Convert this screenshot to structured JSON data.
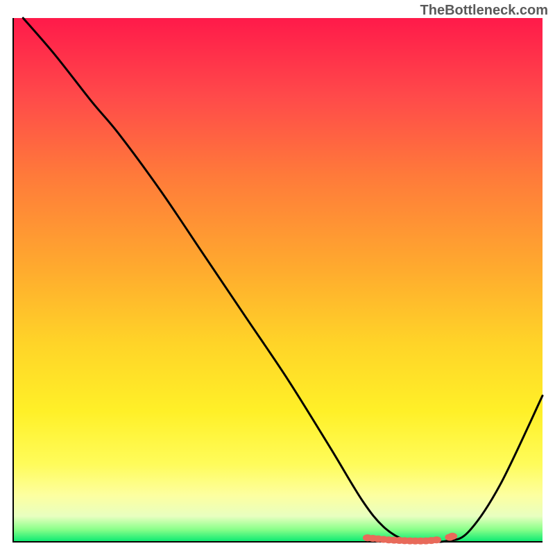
{
  "watermark": "TheBottleneck.com",
  "chart_data": {
    "type": "line",
    "title": "",
    "xlabel": "",
    "ylabel": "",
    "xlim": [
      0,
      100
    ],
    "ylim": [
      0,
      100
    ],
    "series": [
      {
        "name": "bottleneck-curve",
        "x": [
          2,
          8,
          15,
          20,
          28,
          36,
          44,
          52,
          60,
          66,
          70,
          74,
          78,
          82,
          86,
          92,
          100
        ],
        "y": [
          100,
          93,
          84,
          78,
          67,
          55,
          43,
          31,
          18,
          8,
          3,
          0.5,
          0.2,
          0.3,
          2,
          11,
          28
        ]
      }
    ],
    "markers": {
      "name": "optimal-range",
      "color": "#e86a5a",
      "x": [
        67,
        68,
        69,
        70,
        71,
        72,
        73,
        74,
        75,
        76,
        77,
        78,
        79,
        80,
        82.5,
        83
      ],
      "y": [
        0.9,
        0.8,
        0.7,
        0.6,
        0.5,
        0.45,
        0.4,
        0.35,
        0.32,
        0.3,
        0.3,
        0.32,
        0.38,
        0.5,
        1.0,
        1.2
      ]
    },
    "gradient_stops": [
      {
        "pos": 0,
        "color": "#ff1a4a"
      },
      {
        "pos": 0.15,
        "color": "#ff4a4a"
      },
      {
        "pos": 0.3,
        "color": "#ff7a3a"
      },
      {
        "pos": 0.48,
        "color": "#ffab2e"
      },
      {
        "pos": 0.62,
        "color": "#ffd428"
      },
      {
        "pos": 0.75,
        "color": "#fff028"
      },
      {
        "pos": 0.85,
        "color": "#fffc5a"
      },
      {
        "pos": 0.91,
        "color": "#fdffa0"
      },
      {
        "pos": 0.95,
        "color": "#e8ffc0"
      },
      {
        "pos": 0.975,
        "color": "#8aff8a"
      },
      {
        "pos": 1.0,
        "color": "#00e870"
      }
    ]
  }
}
